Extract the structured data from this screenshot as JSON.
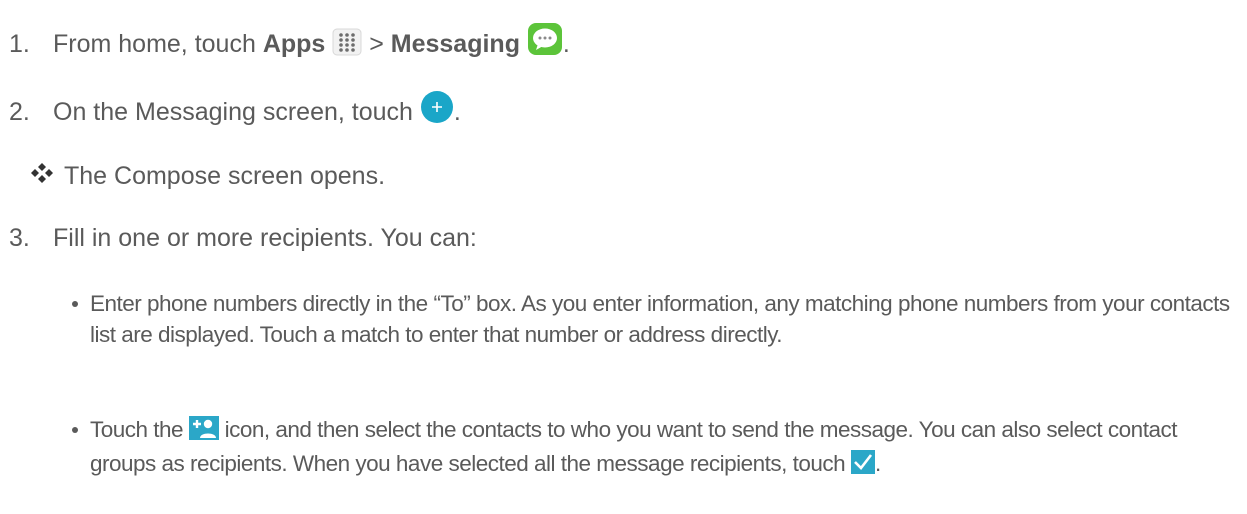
{
  "steps": [
    {
      "number": "1.",
      "text_a": "From home, touch ",
      "bold_a": "Apps",
      "text_b": " > ",
      "bold_b": "Messaging",
      "text_c": "."
    },
    {
      "number": "2.",
      "text_a": "On the Messaging screen, touch ",
      "text_c": "."
    },
    {
      "number": "3.",
      "text_a": "Fill in one or more recipients. You can:"
    }
  ],
  "result": {
    "text": "The Compose screen opens."
  },
  "bullets": [
    {
      "text": "Enter phone numbers directly in the “To” box. As you enter information, any matching phone numbers from your contacts list are displayed. Touch a match to enter that number or address directly."
    },
    {
      "text_a": "Touch the ",
      "text_b": " icon, and then select the contacts to who you want to send the message. You can also select contact groups as recipients. When you have selected all the message recipients, touch ",
      "text_c": "."
    }
  ],
  "icons": {
    "apps": "apps-grid-icon",
    "messaging": "messaging-app-icon",
    "compose": "compose-plus-icon",
    "add_contact": "add-contact-icon",
    "checkmark": "checkmark-icon",
    "result_marker": "diamond-bullet-icon"
  },
  "colors": {
    "text": "#5a5a5a",
    "compose": "#1aa6c8",
    "messaging": "#5cc43a",
    "contact": "#2ba7c8",
    "check": "#2ba7c8"
  }
}
